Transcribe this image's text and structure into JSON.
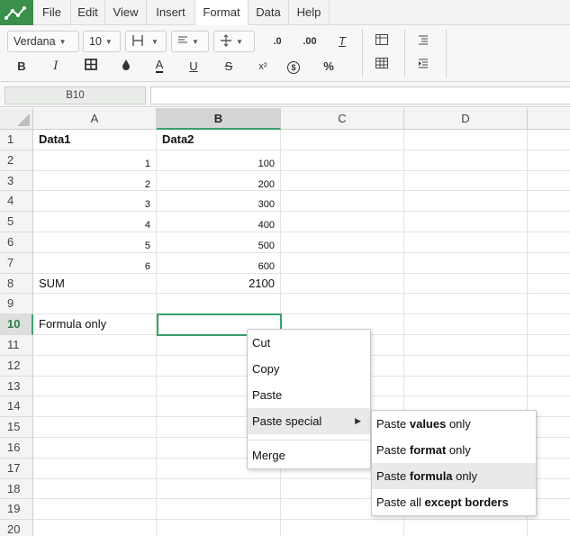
{
  "menubar": {
    "items": [
      "File",
      "Edit",
      "View",
      "Insert",
      "Format",
      "Data",
      "Help"
    ],
    "active": "Format"
  },
  "toolbar": {
    "font_family": "Verdana",
    "font_size": "10",
    "row1_icons": [
      "borders-icon",
      "align-icon",
      "valign-icon",
      "decrease-decimal-icon",
      "increase-decimal-icon",
      "clear-format-icon",
      "freeze-cols-icon",
      "wrap-icon"
    ],
    "glyphs": {
      "bold": "B",
      "italic": "I",
      "text_color": "A",
      "underline": "U",
      "strike": "S",
      "superscript": "x²",
      "currency": "$",
      "percent": "%",
      "dec_decrease": ".0",
      "dec_increase": ".00",
      "clear": "T"
    }
  },
  "formula_bar": {
    "cell_ref": "B10",
    "value": ""
  },
  "grid": {
    "columns": [
      "A",
      "B",
      "C",
      "D"
    ],
    "selected_column": "B",
    "rows": [
      "1",
      "2",
      "3",
      "4",
      "5",
      "6",
      "7",
      "8",
      "9",
      "10",
      "11",
      "12",
      "13",
      "14",
      "15",
      "16",
      "17",
      "18",
      "19",
      "20"
    ],
    "selected_row": "10",
    "cells": {
      "A1": "Data1",
      "B1": "Data2",
      "A2": "1",
      "B2": "100",
      "A3": "2",
      "B3": "200",
      "A4": "3",
      "B4": "300",
      "A5": "4",
      "B5": "400",
      "A6": "5",
      "B6": "500",
      "A7": "6",
      "B7": "600",
      "A8": "SUM",
      "B8": "2100",
      "A10": "Formula only"
    }
  },
  "context_menu": {
    "items": [
      "Cut",
      "Copy",
      "Paste",
      "Paste special",
      "Merge"
    ],
    "hovered": "Paste special"
  },
  "submenu": {
    "items": [
      {
        "pre": "Paste ",
        "bold": "values",
        "post": " only"
      },
      {
        "pre": "Paste ",
        "bold": "format",
        "post": " only"
      },
      {
        "pre": "Paste ",
        "bold": "formula",
        "post": " only"
      },
      {
        "pre": "Paste all ",
        "bold": "except borders",
        "post": ""
      }
    ],
    "hovered_index": 2
  },
  "colors": {
    "accent": "#3aa06b",
    "logo_bg": "#3a8f4a"
  }
}
